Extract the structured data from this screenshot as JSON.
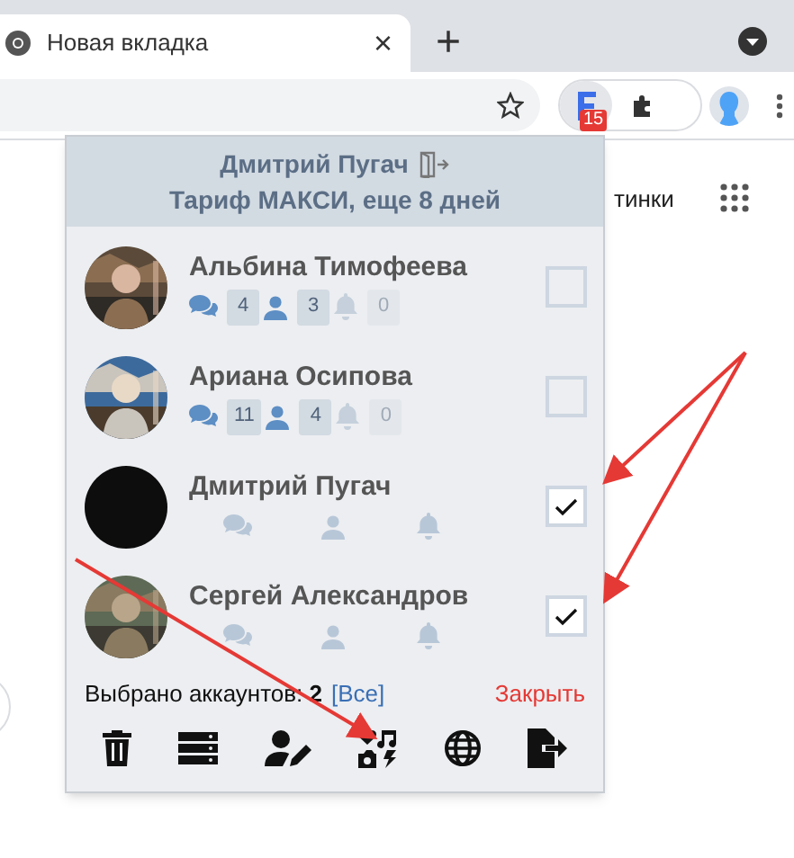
{
  "browser": {
    "tab": {
      "title": "Новая вкладка",
      "close": "×"
    },
    "new_tab": "+",
    "extension_badge": "15",
    "page_text": "тинки"
  },
  "popup": {
    "user": "Дмитрий Пугач",
    "plan": "Тариф МАКСИ, еще 8 дней",
    "accounts": [
      {
        "name": "Альбина Тимофеева",
        "checked": false,
        "stats": [
          {
            "kind": "messages",
            "value": "4",
            "dim": false
          },
          {
            "kind": "friends",
            "value": "3",
            "dim": false
          },
          {
            "kind": "notifications",
            "value": "0",
            "dim": true
          }
        ]
      },
      {
        "name": "Ариана Осипова",
        "checked": false,
        "stats": [
          {
            "kind": "messages",
            "value": "11",
            "dim": false
          },
          {
            "kind": "friends",
            "value": "4",
            "dim": false
          },
          {
            "kind": "notifications",
            "value": "0",
            "dim": true
          }
        ]
      },
      {
        "name": "Дмитрий Пугач",
        "kind": "dark",
        "checked": true,
        "stats": [
          {
            "kind": "messages"
          },
          {
            "kind": "friends"
          },
          {
            "kind": "notifications"
          }
        ]
      },
      {
        "name": "Сергей Александров",
        "checked": true,
        "stats": [
          {
            "kind": "messages"
          },
          {
            "kind": "friends"
          },
          {
            "kind": "notifications"
          }
        ]
      }
    ],
    "footer": {
      "selected_label": "Выбрано аккаунтов:",
      "selected_count": "2",
      "all_link": "[Все]",
      "close": "Закрыть"
    },
    "toolbar": [
      {
        "kind": "delete"
      },
      {
        "kind": "servers"
      },
      {
        "kind": "edit-user"
      },
      {
        "kind": "media"
      },
      {
        "kind": "globe"
      },
      {
        "kind": "export"
      }
    ]
  }
}
